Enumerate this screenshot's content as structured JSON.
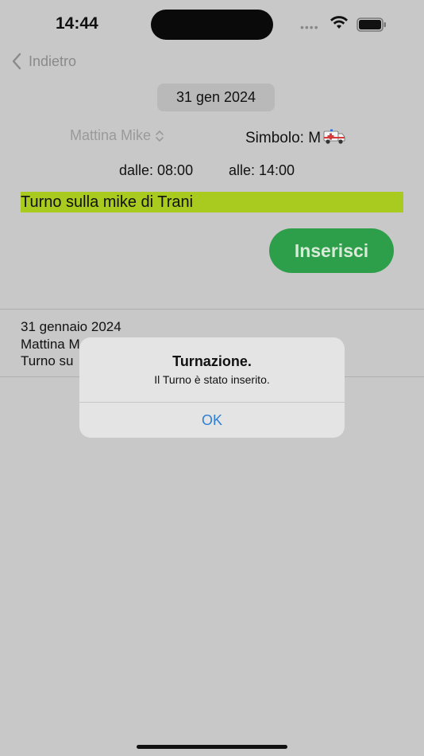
{
  "status_bar": {
    "time": "14:44",
    "signal_icon": "dots-icon",
    "wifi_icon": "wifi-icon",
    "battery_icon": "battery-icon"
  },
  "nav": {
    "back_label": "Indietro",
    "back_icon": "chevron-left-icon"
  },
  "form": {
    "date": "31 gen 2024",
    "shift_type": "Mattina Mike",
    "symbol_label": "Simbolo: M",
    "symbol_icon": "ambulance-icon",
    "from_label": "dalle: 08:00",
    "to_label": "alle: 14:00",
    "note": "Turno sulla mike di Trani",
    "insert_label": "Inserisci"
  },
  "list": [
    {
      "line1": "31 gennaio 2024",
      "line2": "Mattina M",
      "line3": "Turno su"
    }
  ],
  "alert": {
    "title": "Turnazione.",
    "message": "Il Turno è stato inserito.",
    "ok_label": "OK"
  },
  "colors": {
    "background": "#c8c8c8",
    "note_highlight": "#a9ca1e",
    "insert_button": "#2d9f4a",
    "alert_link": "#2f7fd6"
  }
}
